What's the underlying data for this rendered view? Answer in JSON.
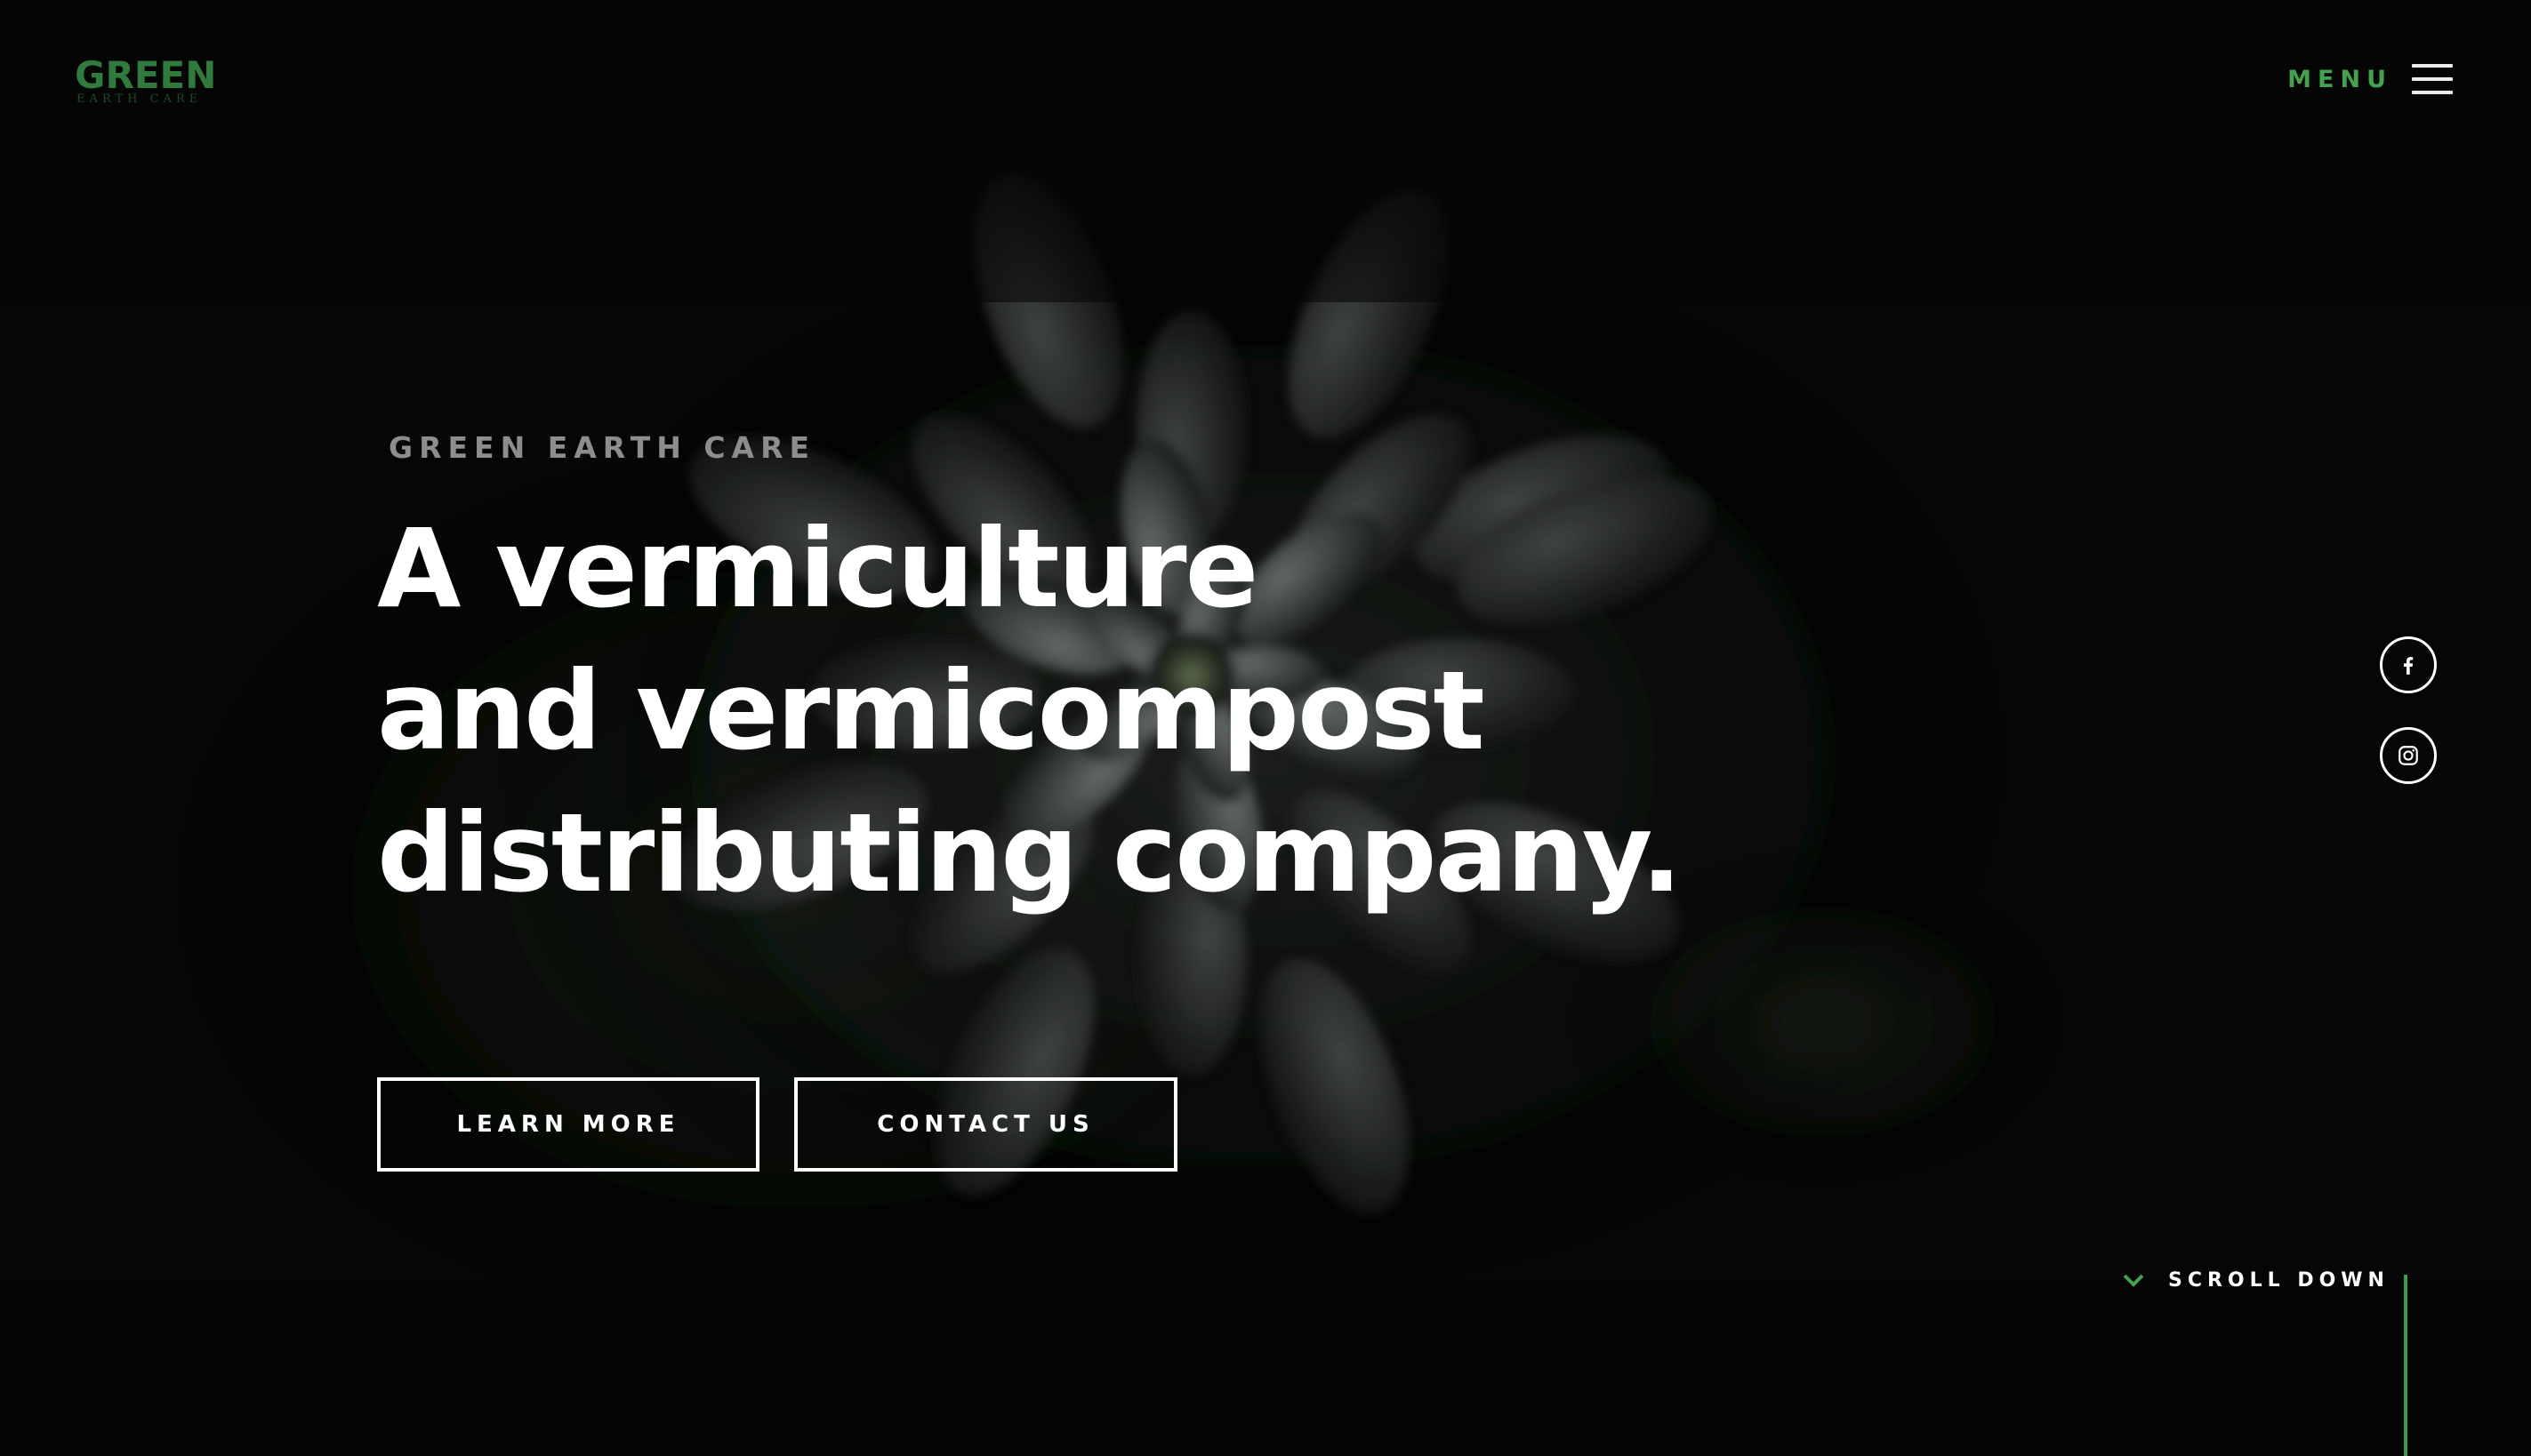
{
  "header": {
    "logo_word": "GREEN",
    "logo_sub": "EARTH CARE",
    "menu_label": "MENU"
  },
  "hero": {
    "eyebrow": "GREEN EARTH CARE",
    "headline_lines": [
      "A vermiculture",
      "and vermicompost",
      "distributing company."
    ],
    "buttons": {
      "learn_more": "LEARN MORE",
      "contact_us": "CONTACT US"
    }
  },
  "social": {
    "facebook_icon": "facebook-icon",
    "instagram_icon": "instagram-icon"
  },
  "scroll": {
    "label": "SCROLL DOWN",
    "icon": "chevron-down-icon"
  },
  "colors": {
    "background": "#070707",
    "brand_green": "#44a14f",
    "logo_green": "#2f7a3c",
    "text": "#ffffff",
    "muted_text": "#8d8d8d"
  }
}
